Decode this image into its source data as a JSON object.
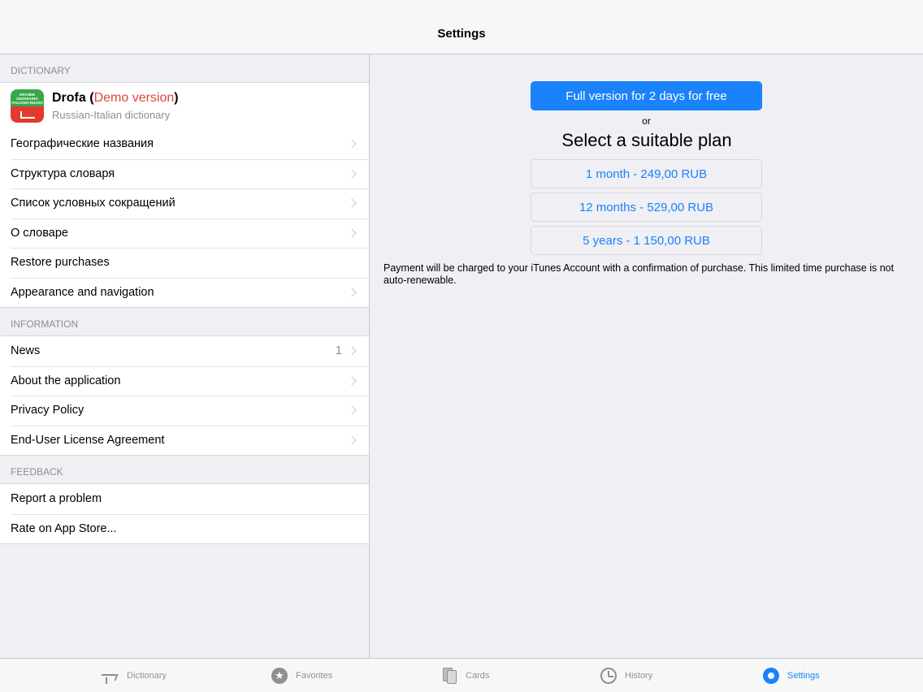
{
  "navbar": {
    "title": "Settings"
  },
  "dictionary_section": {
    "header": "DICTIONARY",
    "dictionary": {
      "name": "Drofa",
      "open_paren": " (",
      "demo_label": "Demo version",
      "close_paren": ")",
      "subtitle": "Russian-Italian dictionary",
      "icon_text": "GRANDE DIZIONARIO ITALIANO-RUSSO"
    },
    "items": [
      {
        "label": "Географические названия",
        "chevron": true
      },
      {
        "label": "Структура словаря",
        "chevron": true
      },
      {
        "label": "Список условных сокращений",
        "chevron": true
      },
      {
        "label": "О словаре",
        "chevron": true
      },
      {
        "label": "Restore purchases",
        "chevron": false
      },
      {
        "label": "Appearance and navigation",
        "chevron": true
      }
    ]
  },
  "information_section": {
    "header": "INFORMATION",
    "items": [
      {
        "label": "News",
        "detail": "1",
        "chevron": true
      },
      {
        "label": "About the application",
        "chevron": true
      },
      {
        "label": "Privacy Policy",
        "chevron": true
      },
      {
        "label": "End-User License Agreement",
        "chevron": true
      }
    ]
  },
  "feedback_section": {
    "header": "FEEDBACK",
    "items": [
      {
        "label": "Report a problem"
      },
      {
        "label": "Rate on App Store..."
      }
    ]
  },
  "purchase": {
    "trial_button": "Full version for 2 days for free",
    "or_text": "or",
    "plan_title": "Select a suitable plan",
    "plans": [
      {
        "label": "1 month - 249,00 RUB"
      },
      {
        "label": "12 months - 529,00 RUB"
      },
      {
        "label": "5 years - 1 150,00 RUB"
      }
    ],
    "notice": "Payment will be charged to your iTunes Account with a confirmation of purchase. This limited time purchase is not auto-renewable."
  },
  "tabbar": {
    "tabs": [
      {
        "label": "Dictionary",
        "icon": "bird-icon",
        "active": false
      },
      {
        "label": "Favorites",
        "icon": "star-icon",
        "active": false
      },
      {
        "label": "Cards",
        "icon": "cards-icon",
        "active": false
      },
      {
        "label": "History",
        "icon": "clock-icon",
        "active": false
      },
      {
        "label": "Settings",
        "icon": "gear-icon",
        "active": true
      }
    ]
  },
  "colors": {
    "accent": "#1a82fb",
    "demo_red": "#e0443a",
    "background": "#efeff4"
  }
}
